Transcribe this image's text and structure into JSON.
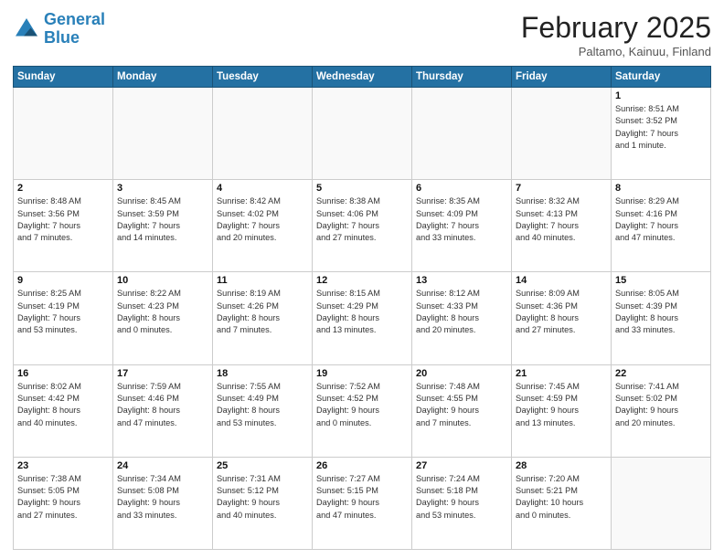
{
  "header": {
    "logo_line1": "General",
    "logo_line2": "Blue",
    "month_title": "February 2025",
    "location": "Paltamo, Kainuu, Finland"
  },
  "weekdays": [
    "Sunday",
    "Monday",
    "Tuesday",
    "Wednesday",
    "Thursday",
    "Friday",
    "Saturday"
  ],
  "weeks": [
    [
      {
        "day": "",
        "info": ""
      },
      {
        "day": "",
        "info": ""
      },
      {
        "day": "",
        "info": ""
      },
      {
        "day": "",
        "info": ""
      },
      {
        "day": "",
        "info": ""
      },
      {
        "day": "",
        "info": ""
      },
      {
        "day": "1",
        "info": "Sunrise: 8:51 AM\nSunset: 3:52 PM\nDaylight: 7 hours\nand 1 minute."
      }
    ],
    [
      {
        "day": "2",
        "info": "Sunrise: 8:48 AM\nSunset: 3:56 PM\nDaylight: 7 hours\nand 7 minutes."
      },
      {
        "day": "3",
        "info": "Sunrise: 8:45 AM\nSunset: 3:59 PM\nDaylight: 7 hours\nand 14 minutes."
      },
      {
        "day": "4",
        "info": "Sunrise: 8:42 AM\nSunset: 4:02 PM\nDaylight: 7 hours\nand 20 minutes."
      },
      {
        "day": "5",
        "info": "Sunrise: 8:38 AM\nSunset: 4:06 PM\nDaylight: 7 hours\nand 27 minutes."
      },
      {
        "day": "6",
        "info": "Sunrise: 8:35 AM\nSunset: 4:09 PM\nDaylight: 7 hours\nand 33 minutes."
      },
      {
        "day": "7",
        "info": "Sunrise: 8:32 AM\nSunset: 4:13 PM\nDaylight: 7 hours\nand 40 minutes."
      },
      {
        "day": "8",
        "info": "Sunrise: 8:29 AM\nSunset: 4:16 PM\nDaylight: 7 hours\nand 47 minutes."
      }
    ],
    [
      {
        "day": "9",
        "info": "Sunrise: 8:25 AM\nSunset: 4:19 PM\nDaylight: 7 hours\nand 53 minutes."
      },
      {
        "day": "10",
        "info": "Sunrise: 8:22 AM\nSunset: 4:23 PM\nDaylight: 8 hours\nand 0 minutes."
      },
      {
        "day": "11",
        "info": "Sunrise: 8:19 AM\nSunset: 4:26 PM\nDaylight: 8 hours\nand 7 minutes."
      },
      {
        "day": "12",
        "info": "Sunrise: 8:15 AM\nSunset: 4:29 PM\nDaylight: 8 hours\nand 13 minutes."
      },
      {
        "day": "13",
        "info": "Sunrise: 8:12 AM\nSunset: 4:33 PM\nDaylight: 8 hours\nand 20 minutes."
      },
      {
        "day": "14",
        "info": "Sunrise: 8:09 AM\nSunset: 4:36 PM\nDaylight: 8 hours\nand 27 minutes."
      },
      {
        "day": "15",
        "info": "Sunrise: 8:05 AM\nSunset: 4:39 PM\nDaylight: 8 hours\nand 33 minutes."
      }
    ],
    [
      {
        "day": "16",
        "info": "Sunrise: 8:02 AM\nSunset: 4:42 PM\nDaylight: 8 hours\nand 40 minutes."
      },
      {
        "day": "17",
        "info": "Sunrise: 7:59 AM\nSunset: 4:46 PM\nDaylight: 8 hours\nand 47 minutes."
      },
      {
        "day": "18",
        "info": "Sunrise: 7:55 AM\nSunset: 4:49 PM\nDaylight: 8 hours\nand 53 minutes."
      },
      {
        "day": "19",
        "info": "Sunrise: 7:52 AM\nSunset: 4:52 PM\nDaylight: 9 hours\nand 0 minutes."
      },
      {
        "day": "20",
        "info": "Sunrise: 7:48 AM\nSunset: 4:55 PM\nDaylight: 9 hours\nand 7 minutes."
      },
      {
        "day": "21",
        "info": "Sunrise: 7:45 AM\nSunset: 4:59 PM\nDaylight: 9 hours\nand 13 minutes."
      },
      {
        "day": "22",
        "info": "Sunrise: 7:41 AM\nSunset: 5:02 PM\nDaylight: 9 hours\nand 20 minutes."
      }
    ],
    [
      {
        "day": "23",
        "info": "Sunrise: 7:38 AM\nSunset: 5:05 PM\nDaylight: 9 hours\nand 27 minutes."
      },
      {
        "day": "24",
        "info": "Sunrise: 7:34 AM\nSunset: 5:08 PM\nDaylight: 9 hours\nand 33 minutes."
      },
      {
        "day": "25",
        "info": "Sunrise: 7:31 AM\nSunset: 5:12 PM\nDaylight: 9 hours\nand 40 minutes."
      },
      {
        "day": "26",
        "info": "Sunrise: 7:27 AM\nSunset: 5:15 PM\nDaylight: 9 hours\nand 47 minutes."
      },
      {
        "day": "27",
        "info": "Sunrise: 7:24 AM\nSunset: 5:18 PM\nDaylight: 9 hours\nand 53 minutes."
      },
      {
        "day": "28",
        "info": "Sunrise: 7:20 AM\nSunset: 5:21 PM\nDaylight: 10 hours\nand 0 minutes."
      },
      {
        "day": "",
        "info": ""
      }
    ]
  ]
}
